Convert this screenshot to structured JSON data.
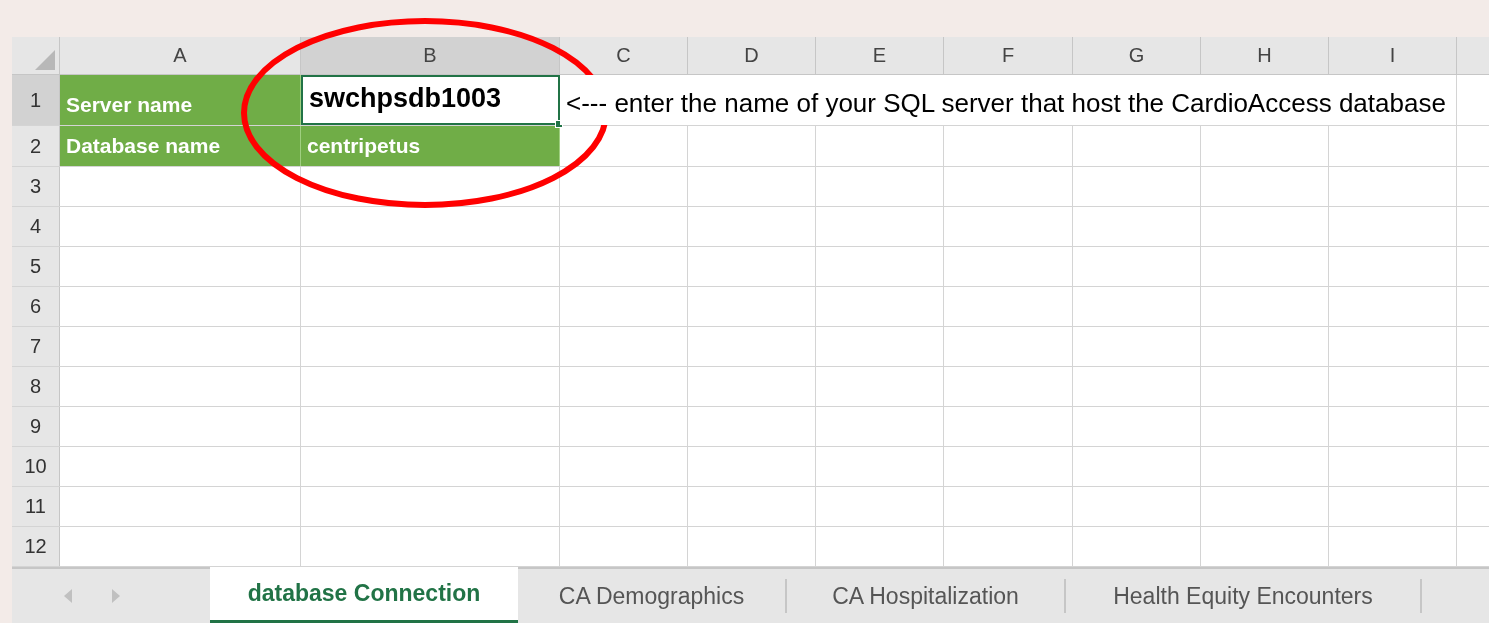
{
  "columns": [
    {
      "label": "A",
      "selected": false
    },
    {
      "label": "B",
      "selected": true
    },
    {
      "label": "C",
      "selected": false
    },
    {
      "label": "D",
      "selected": false
    },
    {
      "label": "E",
      "selected": false
    },
    {
      "label": "F",
      "selected": false
    },
    {
      "label": "G",
      "selected": false
    },
    {
      "label": "H",
      "selected": false
    },
    {
      "label": "I",
      "selected": false
    }
  ],
  "rows": [
    {
      "label": "1",
      "selected": true,
      "cells": [
        {
          "text": "Server name",
          "highlighted": true,
          "selected": false
        },
        {
          "text": "swchpsdb1003",
          "highlighted": false,
          "selected": true
        },
        {
          "text": "<--- enter the name of your SQL server that host the CardioAccess database",
          "highlighted": false,
          "selected": false
        }
      ]
    },
    {
      "label": "2",
      "selected": false,
      "cells": [
        {
          "text": "Database name",
          "highlighted": true,
          "selected": false
        },
        {
          "text": "centripetus",
          "highlighted": true,
          "selected": false
        }
      ]
    },
    {
      "label": "3",
      "selected": false
    },
    {
      "label": "4",
      "selected": false
    },
    {
      "label": "5",
      "selected": false
    },
    {
      "label": "6",
      "selected": false
    },
    {
      "label": "7",
      "selected": false
    },
    {
      "label": "8",
      "selected": false
    },
    {
      "label": "9",
      "selected": false
    },
    {
      "label": "10",
      "selected": false
    },
    {
      "label": "11",
      "selected": false
    },
    {
      "label": "12",
      "selected": false
    }
  ],
  "sheet_tabs": [
    {
      "label": "database Connection",
      "selected": true
    },
    {
      "label": "CA Demographics",
      "selected": false
    },
    {
      "label": "CA Hospitalization",
      "selected": false
    },
    {
      "label": "Health Equity Encounters",
      "selected": false
    }
  ]
}
